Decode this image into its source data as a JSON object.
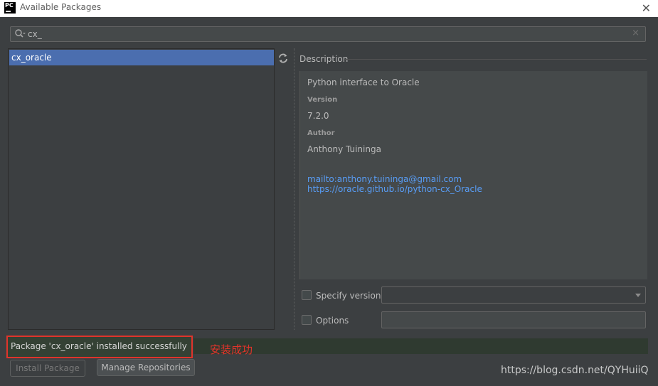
{
  "window": {
    "app_icon_text": "PC",
    "title": "Available Packages",
    "close_glyph": "✕"
  },
  "search": {
    "value": "cx_",
    "clear_glyph": "×"
  },
  "packages": {
    "items": [
      {
        "label": "cx_oracle",
        "selected": true
      }
    ]
  },
  "description": {
    "section_label": "Description",
    "summary": "Python interface to Oracle",
    "version_heading": "Version",
    "version": "7.2.0",
    "author_heading": "Author",
    "author": "Anthony Tuininga",
    "links": [
      "mailto:anthony.tuininga@gmail.com",
      "https://oracle.github.io/python-cx_Oracle"
    ]
  },
  "options": {
    "specify_version_label": "Specify version",
    "options_label": "Options",
    "specify_version_checked": false,
    "options_checked": false
  },
  "status": {
    "message": "Package 'cx_oracle' installed successfully",
    "annotation": "安装成功"
  },
  "buttons": {
    "install": "Install Package",
    "manage": "Manage Repositories"
  },
  "watermark": "https://blog.csdn.net/QYHuiiQ",
  "colors": {
    "selection": "#4b6eaf",
    "link": "#589df6",
    "highlight": "#e0342b"
  }
}
